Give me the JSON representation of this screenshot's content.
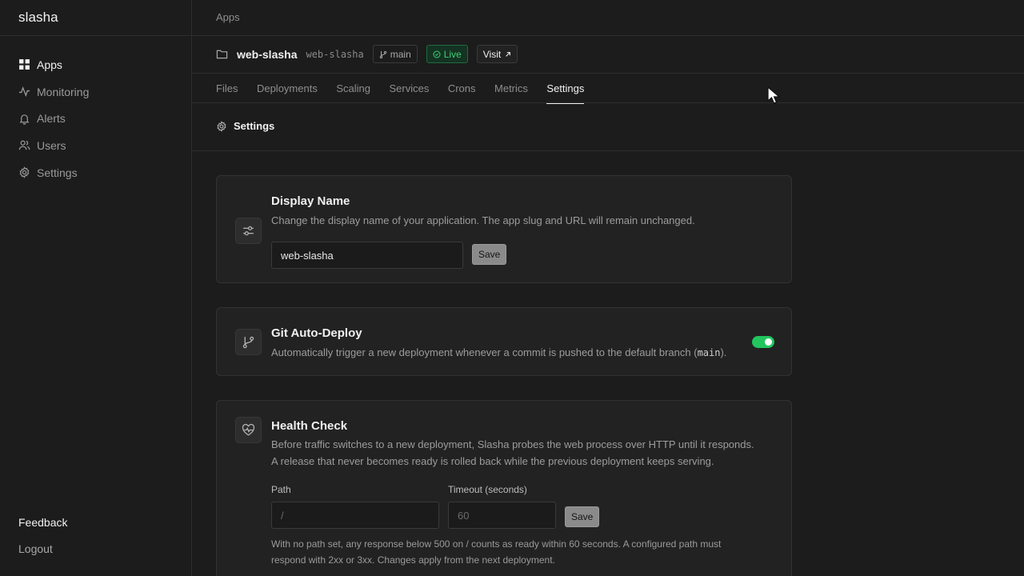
{
  "brand": "slasha",
  "sidebar": {
    "items": [
      {
        "label": "Apps",
        "icon": "grid-icon",
        "active": true
      },
      {
        "label": "Monitoring",
        "icon": "activity-icon"
      },
      {
        "label": "Alerts",
        "icon": "bell-icon"
      },
      {
        "label": "Users",
        "icon": "users-icon"
      },
      {
        "label": "Settings",
        "icon": "gear-icon"
      }
    ],
    "feedback": "Feedback",
    "logout": "Logout"
  },
  "breadcrumb": "Apps",
  "app": {
    "name": "web-slasha",
    "slug": "web-slasha",
    "branch": "main",
    "status": "Live",
    "visit": "Visit"
  },
  "tabs": [
    "Files",
    "Deployments",
    "Scaling",
    "Services",
    "Crons",
    "Metrics",
    "Settings"
  ],
  "active_tab": "Settings",
  "section_title": "Settings",
  "display_name": {
    "title": "Display Name",
    "description": "Change the display name of your application. The app slug and URL will remain unchanged.",
    "value": "web-slasha",
    "save": "Save"
  },
  "git_auto_deploy": {
    "title": "Git Auto-Deploy",
    "description_pre": "Automatically trigger a new deployment whenever a commit is pushed to the default branch (",
    "branch": "main",
    "description_post": ").",
    "enabled": true
  },
  "health_check": {
    "title": "Health Check",
    "description_1": "Before traffic switches to a new deployment, Slasha probes the web process over HTTP until it responds.",
    "description_2": "A release that never becomes ready is rolled back while the previous deployment keeps serving.",
    "path_label": "Path",
    "path_placeholder": "/",
    "timeout_label": "Timeout (seconds)",
    "timeout_placeholder": "60",
    "save": "Save",
    "note_1": "With no path set, any response below 500 on / counts as ready within 60 seconds. A configured path must",
    "note_2": "respond with 2xx or 3xx. Changes apply from the next deployment."
  },
  "colors": {
    "background": "#1c1c1c",
    "card": "#222222",
    "accent_green": "#22c55e",
    "live_text": "#3ecf72"
  }
}
